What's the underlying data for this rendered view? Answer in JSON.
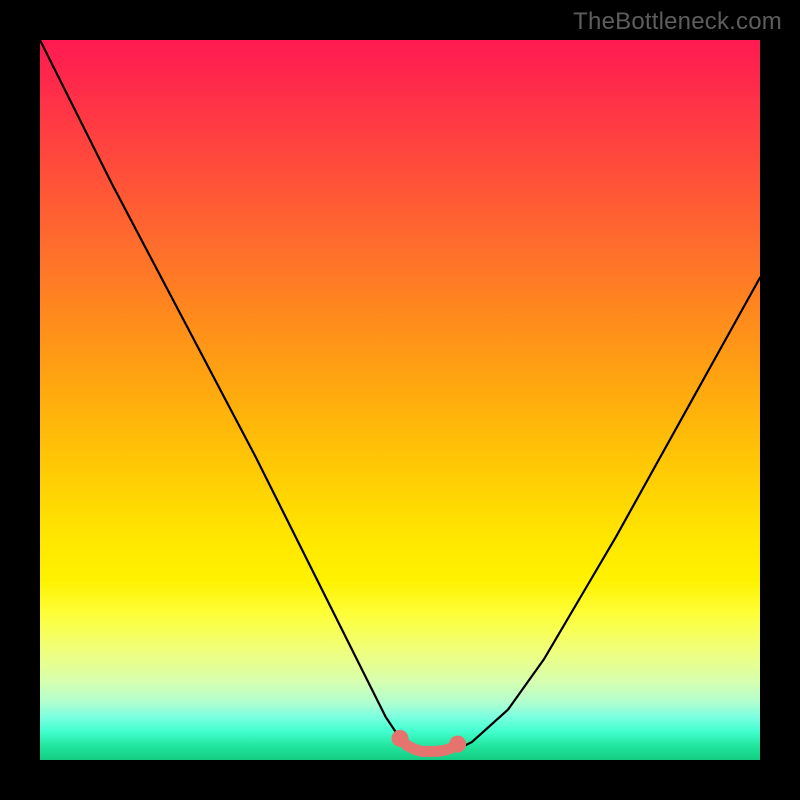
{
  "watermark": "TheBottleneck.com",
  "colors": {
    "frame": "#000000",
    "curve": "#000000",
    "marker": "#e4746d",
    "marker_outline": "#b85b55"
  },
  "chart_data": {
    "type": "line",
    "title": "",
    "xlabel": "",
    "ylabel": "",
    "xlim": [
      0,
      100
    ],
    "ylim": [
      0,
      100
    ],
    "series": [
      {
        "name": "bottleneck-curve",
        "x": [
          0,
          5,
          10,
          15,
          20,
          25,
          30,
          35,
          40,
          45,
          48,
          50,
          52,
          54,
          56,
          58,
          60,
          65,
          70,
          75,
          80,
          85,
          90,
          95,
          100
        ],
        "values": [
          100,
          90,
          80,
          70.5,
          61,
          51.5,
          42,
          32,
          22,
          12,
          6,
          3,
          1.5,
          1.2,
          1.2,
          1.5,
          2.5,
          7,
          14,
          22.5,
          31,
          40,
          49,
          58,
          67
        ]
      },
      {
        "name": "optimal-zone-marker",
        "x": [
          50,
          51,
          52,
          53,
          54,
          55,
          56,
          57,
          58
        ],
        "values": [
          3.0,
          2.0,
          1.5,
          1.2,
          1.2,
          1.2,
          1.3,
          1.6,
          2.2
        ]
      }
    ]
  }
}
